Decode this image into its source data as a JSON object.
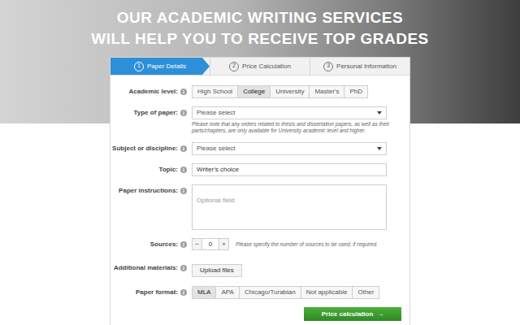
{
  "hero": {
    "headline": [
      "OUR ACADEMIC WRITING SERVICES",
      "WILL HELP YOU TO RECEIVE TOP GRADES"
    ]
  },
  "steps": [
    {
      "number": "1",
      "label": "Paper Details",
      "selected": true
    },
    {
      "number": "2",
      "label": "Price Calculation",
      "selected": false
    },
    {
      "number": "3",
      "label": "Personal Information",
      "selected": false
    }
  ],
  "form": {
    "academic_level": {
      "label": "Academic level:",
      "options": [
        {
          "label": "High School",
          "selected": false
        },
        {
          "label": "College",
          "selected": true
        },
        {
          "label": "University",
          "selected": false
        },
        {
          "label": "Master's",
          "selected": false
        },
        {
          "label": "PhD",
          "selected": false
        }
      ]
    },
    "type_of_paper": {
      "label": "Type of paper:",
      "value": "Please select",
      "note": "Please note that any orders related to thesis and dissertation papers, as well as their parts/chapters, are only available for University academic level and higher."
    },
    "subject": {
      "label": "Subject or discipline:",
      "value": "Please select"
    },
    "topic": {
      "label": "Topic:",
      "value": "Writer's choice"
    },
    "instructions": {
      "label": "Paper instructions:",
      "placeholder": "Optional field"
    },
    "sources": {
      "label": "Sources:",
      "minus": "−",
      "value": "0",
      "plus": "+",
      "note": "Please specify the number of sources to be used, if required."
    },
    "materials": {
      "label": "Additional materials:",
      "button": "Upload files"
    },
    "format": {
      "label": "Paper format:",
      "options": [
        {
          "label": "MLA",
          "selected": true
        },
        {
          "label": "APA",
          "selected": false
        },
        {
          "label": "Chicago/Turabian",
          "selected": false
        },
        {
          "label": "Not applicable",
          "selected": false
        },
        {
          "label": "Other",
          "selected": false
        }
      ]
    }
  },
  "submit": {
    "label": "Price calculation",
    "arrow": "→"
  }
}
